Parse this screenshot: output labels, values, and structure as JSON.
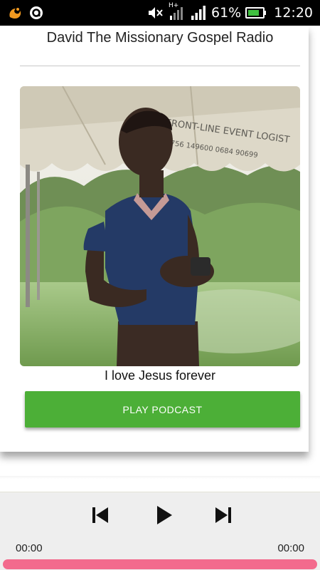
{
  "status_bar": {
    "battery_percent": "61%",
    "time": "12:20",
    "network_type": "H+",
    "icons": [
      "uc-browser-icon",
      "app-notification-icon",
      "mute-icon",
      "signal-icon",
      "battery-icon"
    ]
  },
  "card": {
    "title": "David The Missionary Gospel Radio",
    "caption": "I love Jesus forever",
    "play_button_label": "PLAY PODCAST",
    "tent_text_line1": "FRONT-LINE EVENT LOGIST",
    "tent_text_line2": "0756 149600    0684 90699"
  },
  "player": {
    "current_time": "00:00",
    "total_time": "00:00",
    "progress": 1.0,
    "accent_color": "#f36a8d",
    "controls": [
      "previous-icon",
      "play-icon",
      "next-icon"
    ]
  },
  "colors": {
    "play_button": "#4caf37",
    "status_bar": "#000000",
    "player_bg": "#eeeeee"
  }
}
